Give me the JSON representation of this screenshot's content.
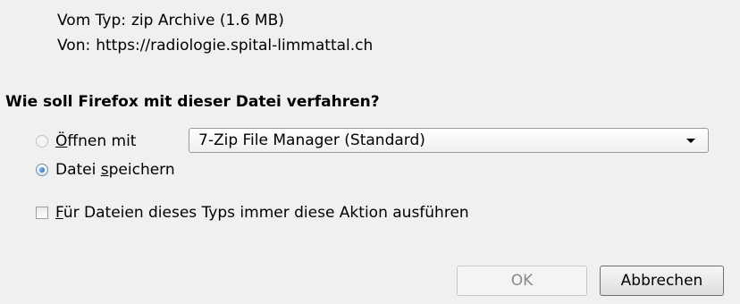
{
  "info": {
    "type_label": "Vom Typ:",
    "type_value": "zip Archive (1.6 MB)",
    "from_label": "Von:",
    "from_value": "https://radiologie.spital-limmattal.ch"
  },
  "question": "Wie soll Firefox mit dieser Datei verfahren?",
  "options": {
    "open": {
      "accel": "Ö",
      "rest": "ffnen mit",
      "selected": false
    },
    "application_select": {
      "value": "7-Zip File Manager (Standard)"
    },
    "save": {
      "prefix": "Datei ",
      "accel": "s",
      "rest": "peichern",
      "selected": true
    },
    "always": {
      "accel": "F",
      "rest": "ür Dateien dieses Typs immer diese Aktion ausführen",
      "checked": false
    }
  },
  "buttons": {
    "ok": "OK",
    "cancel": "Abbrechen"
  }
}
